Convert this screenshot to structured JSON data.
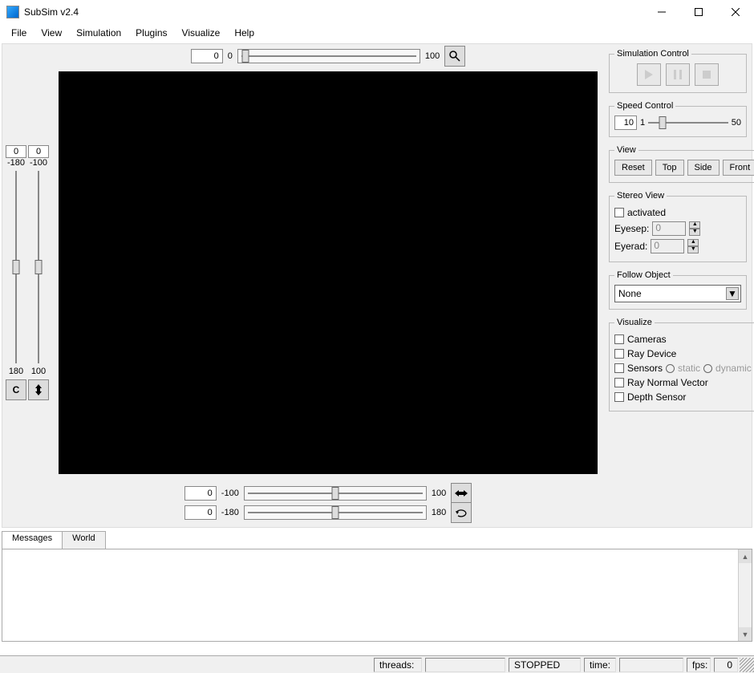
{
  "window": {
    "title": "SubSim v2.4"
  },
  "menu": {
    "items": [
      "File",
      "View",
      "Simulation",
      "Plugins",
      "Visualize",
      "Help"
    ]
  },
  "top_slider": {
    "value": "0",
    "min": "0",
    "max": "100"
  },
  "left_sliders": {
    "a": {
      "value": "0",
      "min": "-180",
      "max": "180"
    },
    "b": {
      "value": "0",
      "min": "-100",
      "max": "100"
    }
  },
  "bottom_sliders": {
    "row1": {
      "value": "0",
      "min": "-100",
      "max": "100"
    },
    "row2": {
      "value": "0",
      "min": "-180",
      "max": "180"
    }
  },
  "sim_control": {
    "legend": "Simulation Control"
  },
  "speed": {
    "legend": "Speed Control",
    "value": "10",
    "min": "1",
    "max": "50"
  },
  "view": {
    "legend": "View",
    "reset": "Reset",
    "top": "Top",
    "side": "Side",
    "front": "Front"
  },
  "stereo": {
    "legend": "Stereo View",
    "activated": "activated",
    "eyesep_label": "Eyesep:",
    "eyesep": "0",
    "eyerad_label": "Eyerad:",
    "eyerad": "0"
  },
  "follow": {
    "legend": "Follow Object",
    "selected": "None"
  },
  "visualize": {
    "legend": "Visualize",
    "cameras": "Cameras",
    "ray_device": "Ray Device",
    "sensors": "Sensors",
    "static": "static",
    "dynamic": "dynamic",
    "ray_normal": "Ray Normal Vector",
    "depth": "Depth Sensor"
  },
  "tabs": {
    "messages": "Messages",
    "world": "World"
  },
  "status": {
    "threads_label": "threads:",
    "threads": "",
    "state": "STOPPED",
    "time_label": "time:",
    "time": "",
    "fps_label": "fps:",
    "fps": "0"
  }
}
